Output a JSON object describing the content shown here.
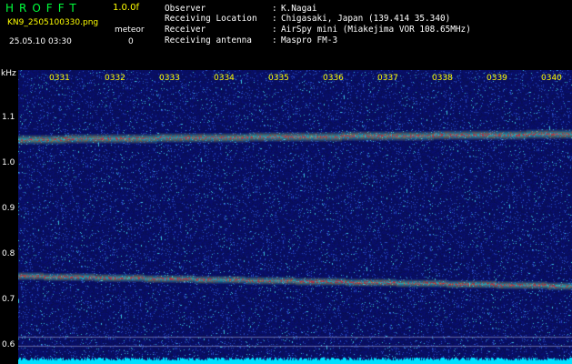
{
  "header": {
    "app_title": "HROFFT",
    "version": "1.0.0f",
    "file_name": "KN9_2505100330.png",
    "meteor_label": "meteor",
    "date_time": "25.05.10 03:30",
    "meteor_count": "0"
  },
  "info": [
    {
      "key": "Observer",
      "value": "K.Nagai"
    },
    {
      "key": "Receiving Location",
      "value": "Chigasaki, Japan (139.414 35.340)"
    },
    {
      "key": "Receiver",
      "value": "AirSpy mini (Miakejima VOR 108.65MHz)"
    },
    {
      "key": "Receiving antenna",
      "value": "Maspro FM-3"
    }
  ],
  "info_separator": ":",
  "axis": {
    "unit": "kHz",
    "y_ticks": [
      "1.1",
      "1.0",
      "0.9",
      "0.8",
      "0.7",
      "0.6"
    ],
    "x_ticks": [
      "0331",
      "0332",
      "0333",
      "0334",
      "0335",
      "0336",
      "0337",
      "0338",
      "0339",
      "0340"
    ]
  },
  "colors": {
    "background": "#000000",
    "plot_background": "#0a1060",
    "title_green": "#00ff3c",
    "label_yellow": "#ffff00",
    "text_white": "#ffffff",
    "baseline_cyan": "#00e0ff"
  }
}
